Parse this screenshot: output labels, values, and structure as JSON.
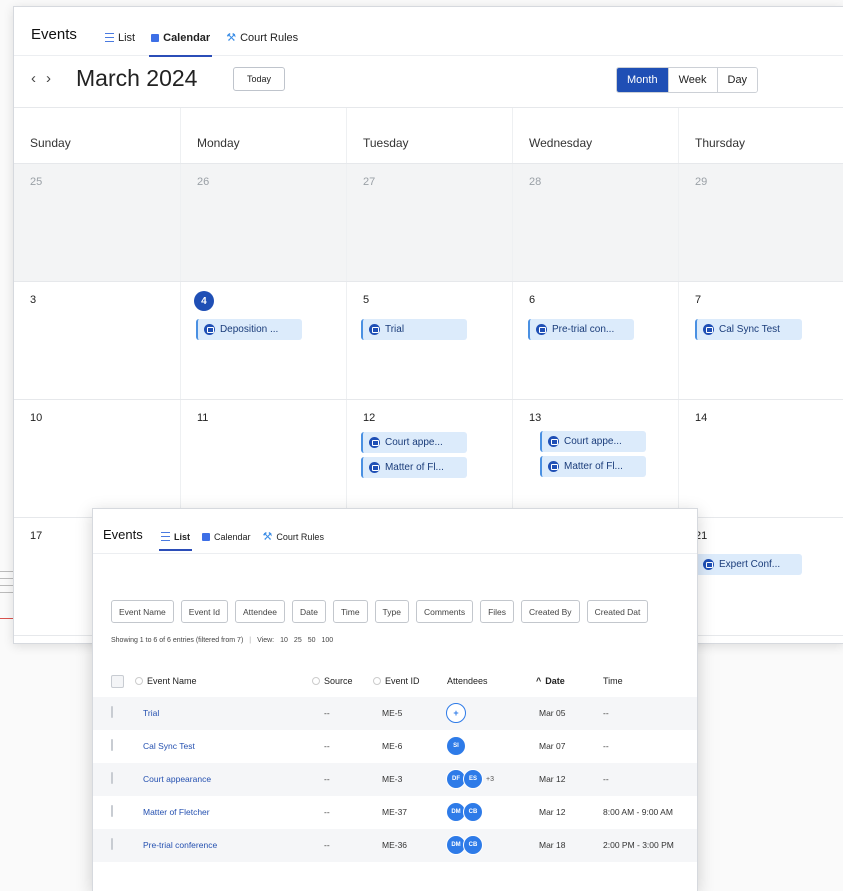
{
  "calendar": {
    "title": "Events",
    "tabs": [
      {
        "label": "List",
        "icon": "list-icon"
      },
      {
        "label": "Calendar",
        "icon": "calendar-icon"
      },
      {
        "label": "Court Rules",
        "icon": "gavel-icon"
      }
    ],
    "active_tab": "Calendar",
    "month_title": "March 2024",
    "prev_glyph": "‹",
    "next_glyph": "›",
    "today_label": "Today",
    "views": [
      "Month",
      "Week",
      "Day"
    ],
    "active_view": "Month",
    "weekdays": [
      "Sunday",
      "Monday",
      "Tuesday",
      "Wednesday",
      "Thursday"
    ],
    "weeks": [
      [
        "25",
        "26",
        "27",
        "28",
        "29"
      ],
      [
        "3",
        "4",
        "5",
        "6",
        "7"
      ],
      [
        "10",
        "11",
        "12",
        "13",
        "14"
      ],
      [
        "17",
        "",
        "",
        "",
        "21"
      ]
    ],
    "today_date": "4",
    "events": {
      "deposition": "Deposition ...",
      "trial": "Trial",
      "pretrial": "Pre-trial con...",
      "calsync": "Cal Sync Test",
      "court12": "Court appe...",
      "matter12": "Matter of Fl...",
      "court13": "Court appe...",
      "matter13": "Matter of Fl...",
      "expert": "Expert Conf..."
    }
  },
  "list": {
    "title": "Events",
    "tabs": [
      {
        "label": "List",
        "icon": "list-icon"
      },
      {
        "label": "Calendar",
        "icon": "calendar-icon"
      },
      {
        "label": "Court Rules",
        "icon": "gavel-icon"
      }
    ],
    "active_tab": "List",
    "filters": [
      "Event Name",
      "Event Id",
      "Attendee",
      "Date",
      "Time",
      "Type",
      "Comments",
      "Files",
      "Created By",
      "Created Dat"
    ],
    "showing_text": "Showing 1 to 6 of 6 entries (filtered from 7)",
    "view_label": "View:",
    "view_sizes": [
      "10",
      "25",
      "50",
      "100"
    ],
    "columns": {
      "name": "Event Name",
      "source": "Source",
      "event_id": "Event ID",
      "attendees": "Attendees",
      "date": "Date",
      "date_sort_glyph": "^",
      "time": "Time"
    },
    "rows": [
      {
        "name": "Trial",
        "source": "--",
        "id": "ME-5",
        "attendees": [],
        "date": "Mar 05",
        "time": "--"
      },
      {
        "name": "Cal Sync Test",
        "source": "--",
        "id": "ME-6",
        "attendees": [
          "SI"
        ],
        "date": "Mar 07",
        "time": "--"
      },
      {
        "name": "Court appearance",
        "source": "--",
        "id": "ME-3",
        "attendees": [
          "DF",
          "ES"
        ],
        "more": "+3",
        "date": "Mar 12",
        "time": "--"
      },
      {
        "name": "Matter of Fletcher",
        "source": "--",
        "id": "ME-37",
        "attendees": [
          "DM",
          "CB"
        ],
        "date": "Mar 12",
        "time": "8:00 AM - 9:00 AM"
      },
      {
        "name": "Pre-trial conference",
        "source": "--",
        "id": "ME-36",
        "attendees": [
          "DM",
          "CB"
        ],
        "date": "Mar 18",
        "time": "2:00 PM - 3:00 PM"
      }
    ],
    "add_attendee_glyph": "+"
  }
}
